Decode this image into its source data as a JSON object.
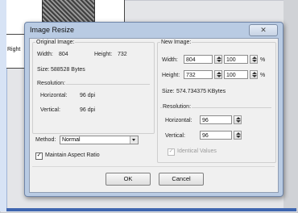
{
  "dialog": {
    "title": "Image Resize",
    "close_glyph": "✕"
  },
  "background": {
    "side_label": "Right"
  },
  "original": {
    "group_label": "Original Image:",
    "width_label": "Width:",
    "width_value": "804",
    "height_label": "Height:",
    "height_value": "732",
    "size_label": "Size:",
    "size_value": "588528 Bytes",
    "resolution_label": "Resolution:",
    "horizontal_label": "Horizontal:",
    "horizontal_value": "96 dpi",
    "vertical_label": "Vertical:",
    "vertical_value": "96 dpi"
  },
  "method": {
    "label": "Method:",
    "selected": "Normal"
  },
  "maintain_aspect": {
    "label": "Maintain Aspect Ratio",
    "checked": true
  },
  "new_image": {
    "group_label": "New Image:",
    "width_label": "Width:",
    "width_value": "804",
    "width_percent": "100",
    "height_label": "Height:",
    "height_value": "732",
    "height_percent": "100",
    "percent_sign": "%",
    "size_label": "Size:",
    "size_value": "574.734375 KBytes",
    "resolution_label": "Resolution:",
    "horizontal_label": "Horizontal:",
    "horizontal_value": "96",
    "vertical_label": "Vertical:",
    "vertical_value": "96",
    "identical_label": "Identical Values",
    "identical_checked": true
  },
  "buttons": {
    "ok": "OK",
    "cancel": "Cancel"
  },
  "icons": {
    "close": "close-icon",
    "spin": "spin-arrows-icon",
    "dropdown": "chevron-down-icon",
    "check": "checkmark-icon"
  }
}
